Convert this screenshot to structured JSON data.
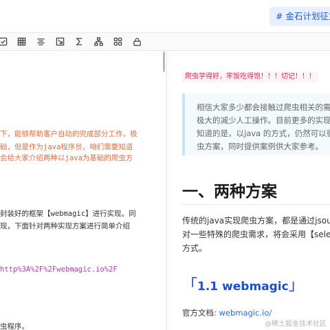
{
  "header": {
    "tag_label": "# 金石计划征文活"
  },
  "toolbar": {
    "icons": [
      "checkbox-icon",
      "table-icon",
      "align-icon",
      "image-icon",
      "sum-icon",
      "hierarchy-icon",
      "grid-icon",
      "lock-icon"
    ]
  },
  "editor": {
    "lines": [
      {
        "text": "下，能够帮助客户自动的完成部分工作，极",
        "style": "orange"
      },
      {
        "text": "础，但是作为java程序员，咱们需要知道",
        "style": "orange"
      },
      {
        "text": "会给大家介绍两种以java为基础的爬虫方",
        "style": "orange"
      },
      {
        "text": "封装好的框架【webmagic】进行实现。同",
        "style": "dark"
      },
      {
        "text": "现，下面针对两种实现方案进行简单介绍",
        "style": "dark"
      },
      {
        "text": "http%3A%2F%2Fwebmagic.io%2F",
        "style": "purple"
      },
      {
        "text": "虫程序。",
        "style": "dark"
      }
    ]
  },
  "preview": {
    "highlight": "爬虫学得好，牢饭吃得饱！！！切记！！！",
    "quote_lines": [
      "相信大家多少都会接触过爬虫相关的需求",
      "极大的减少人工操作。目前更多的实现方",
      "知道的是，以java 的方式，仍然可以很方",
      "虫方案，同时提供案例供大家参考。"
    ],
    "h1": "一、两种方案",
    "para_lines": [
      "传统的java实现爬虫方案，都是通过jsoup的方",
      "对一些特殊的爬虫需求，将会采用【seleniu",
      "方式。"
    ],
    "h2_open": "「",
    "h2_text": "1.1 webmagic",
    "h2_close": "」",
    "doc_label": "官方文档: ",
    "doc_link": "webmagic.io/",
    "watermark": "@稀土掘金技术社区"
  }
}
